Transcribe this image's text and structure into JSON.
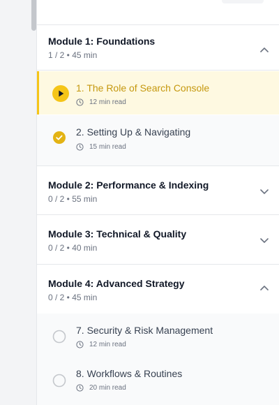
{
  "modules": [
    {
      "title": "Module 1: Foundations",
      "meta": "1 / 2 • 45 min",
      "expanded": true,
      "lessons": [
        {
          "title": "1. The Role of Search Console",
          "read": "12 min read",
          "state": "playing"
        },
        {
          "title": "2. Setting Up & Navigating",
          "read": "15 min read",
          "state": "completed"
        }
      ]
    },
    {
      "title": "Module 2: Performance & Indexing",
      "meta": "0 / 2 • 55 min",
      "expanded": false
    },
    {
      "title": "Module 3: Technical & Quality",
      "meta": "0 / 2 • 40 min",
      "expanded": false
    },
    {
      "title": "Module 4: Advanced Strategy",
      "meta": "0 / 2 • 45 min",
      "expanded": true,
      "lessons": [
        {
          "title": "7. Security & Risk Management",
          "read": "12 min read",
          "state": "not-started"
        },
        {
          "title": "8. Workflows & Routines",
          "read": "20 min read",
          "state": "not-started"
        }
      ]
    }
  ],
  "icons": {
    "chevron_up": "chevron-up-icon",
    "chevron_down": "chevron-down-icon",
    "play": "play-icon",
    "check": "check-icon",
    "clock": "clock-icon",
    "empty_circle": "empty-circle-icon"
  },
  "colors": {
    "accent": "#f5c518",
    "active_bg": "#fef9e1",
    "active_text": "#c5980e"
  }
}
